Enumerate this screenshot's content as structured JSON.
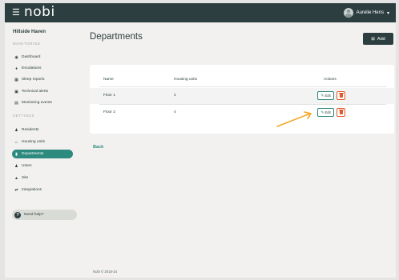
{
  "topbar": {
    "menu_icon": "hamburger-icon",
    "logo": "nobi",
    "user_name": "Aurelie Hens",
    "chevron": "⌄"
  },
  "sidebar": {
    "org_name": "Hillside Haven",
    "sections": {
      "monitoring": "MONITORING",
      "settings": "SETTINGS"
    },
    "items": [
      {
        "label": "Dashboard",
        "icon": "gauge-icon"
      },
      {
        "label": "Escalations",
        "icon": "bulb-icon"
      },
      {
        "label": "Sleep reports",
        "icon": "report-icon"
      },
      {
        "label": "Technical alerts",
        "icon": "alert-icon"
      },
      {
        "label": "Monitoring events",
        "icon": "events-icon"
      },
      {
        "label": "Residents",
        "icon": "people-icon"
      },
      {
        "label": "Housing units",
        "icon": "house-icon"
      },
      {
        "label": "Departments",
        "icon": "building-icon"
      },
      {
        "label": "Users",
        "icon": "users-icon"
      },
      {
        "label": "Site",
        "icon": "home-icon"
      },
      {
        "label": "Integrations",
        "icon": "plug-icon"
      }
    ],
    "active_item": "Departments",
    "help_label": "Need help?"
  },
  "page": {
    "title": "Departments",
    "add_label": "Add"
  },
  "table": {
    "columns": {
      "name": "Name",
      "housing_units": "Housing units",
      "actions": "Actions"
    },
    "rows": [
      {
        "name": "Floor 1",
        "housing_units": "4"
      },
      {
        "name": "Floor 2",
        "housing_units": "4"
      }
    ],
    "edit_label": "Edit"
  },
  "back_label": "Back",
  "footer": "Nobi © 2018-24",
  "colors": {
    "topbar": "#2c3e3f",
    "accent": "#2d8a7f",
    "danger": "#e05a2b",
    "arrow": "#f5a623"
  }
}
